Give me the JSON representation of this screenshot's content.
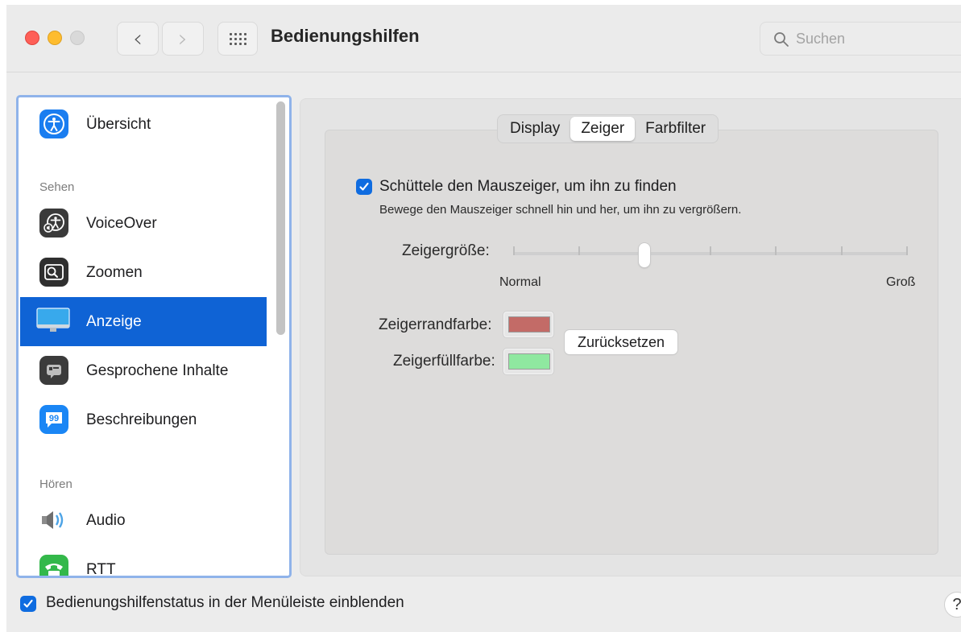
{
  "window": {
    "title": "Bedienungshilfen",
    "search_placeholder": "Suchen"
  },
  "sidebar": {
    "items": [
      {
        "label": "Übersicht",
        "icon": "accessibility-overview-icon"
      },
      {
        "section": "Sehen"
      },
      {
        "label": "VoiceOver",
        "icon": "voiceover-icon"
      },
      {
        "label": "Zoomen",
        "icon": "zoom-icon"
      },
      {
        "label": "Anzeige",
        "icon": "display-icon",
        "selected": true
      },
      {
        "label": "Gesprochene Inhalte",
        "icon": "spoken-content-icon"
      },
      {
        "label": "Beschreibungen",
        "icon": "descriptions-icon"
      },
      {
        "section": "Hören"
      },
      {
        "label": "Audio",
        "icon": "audio-speaker-icon"
      },
      {
        "label": "RTT",
        "icon": "rtt-phone-icon"
      }
    ]
  },
  "tabs": [
    {
      "label": "Display",
      "active": false
    },
    {
      "label": "Zeiger",
      "active": true
    },
    {
      "label": "Farbfilter",
      "active": false
    }
  ],
  "pointer": {
    "shake_checked": true,
    "shake_label": "Schüttele den Mauszeiger, um ihn zu finden",
    "shake_description": "Bewege den Mauszeiger schnell hin und her, um ihn zu vergrößern.",
    "size_label": "Zeigergröße:",
    "size_min_label": "Normal",
    "size_max_label": "Groß",
    "size_ticks": 7,
    "size_value_fraction": 0.333,
    "outline_label": "Zeigerrandfarbe:",
    "outline_color": "#c36b67",
    "fill_label": "Zeigerfüllfarbe:",
    "fill_color": "#8fe8a0",
    "reset_label": "Zurücksetzen"
  },
  "footer": {
    "menu_status_checked": true,
    "menu_status_label": "Bedienungshilfenstatus in der Menüleiste einblenden",
    "help_label": "?"
  },
  "colors": {
    "accent": "#0f63d5",
    "sidebar_focus_ring": "#8fb3ea"
  }
}
